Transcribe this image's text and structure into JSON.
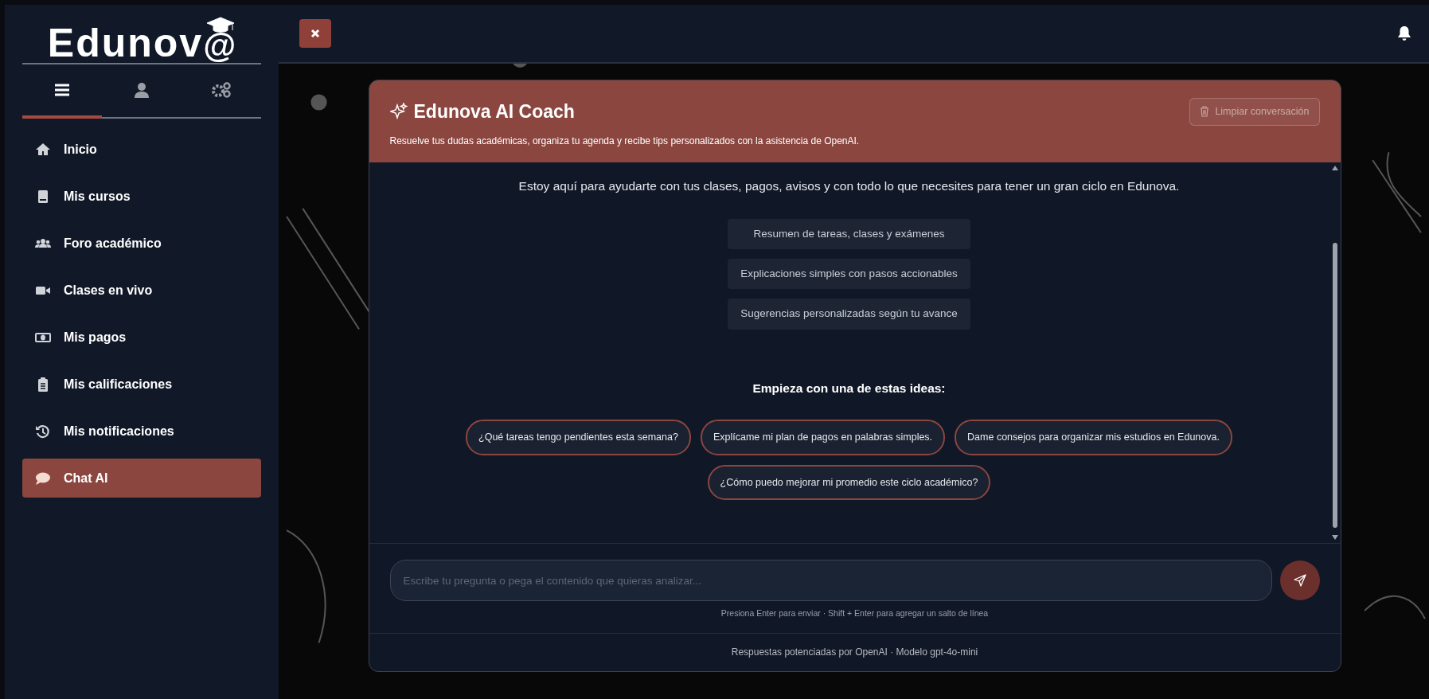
{
  "sidebar": {
    "logo": {
      "text": "Edunov",
      "mark": "@"
    },
    "tabs": [
      {
        "selected": true
      },
      {
        "selected": false
      },
      {
        "selected": false
      }
    ],
    "items": [
      {
        "label": "Inicio",
        "selected": false
      },
      {
        "label": "Mis cursos",
        "selected": false
      },
      {
        "label": "Foro académico",
        "selected": false
      },
      {
        "label": "Clases en vivo",
        "selected": false
      },
      {
        "label": "Mis pagos",
        "selected": false
      },
      {
        "label": "Mis calificaciones",
        "selected": false
      },
      {
        "label": "Mis notificaciones",
        "selected": false
      },
      {
        "label": "Chat AI",
        "selected": true
      }
    ]
  },
  "chat": {
    "title": "Edunova AI Coach",
    "subtitle": "Resuelve tus dudas académicas, organiza tu agenda y recibe tips personalizados con la asistencia de OpenAI.",
    "clear_button": {
      "label": "Limpiar conversación",
      "disabled": true
    },
    "intro": "Estoy aquí para ayudarte con tus clases, pagos, avisos y con todo lo que necesites para tener un gran ciclo en Edunova.",
    "features": [
      "Resumen de tareas, clases y exámenes",
      "Explicaciones simples con pasos accionables",
      "Sugerencias personalizadas según tu avance"
    ],
    "ideas_title": "Empieza con una de estas ideas:",
    "ideas": [
      "¿Qué tareas tengo pendientes esta semana?",
      "Explícame mi plan de pagos en palabras simples.",
      "Dame consejos para organizar mis estudios en Edunova.",
      "¿Cómo puedo mejorar mi promedio este ciclo académico?"
    ],
    "input": {
      "placeholder": "Escribe tu pregunta o pega el contenido que quieras analizar..."
    },
    "hint": "Presiona Enter para enviar · Shift + Enter para agregar un salto de línea",
    "footer": "Respuestas potenciadas por OpenAI · Modelo gpt-4o-mini"
  }
}
